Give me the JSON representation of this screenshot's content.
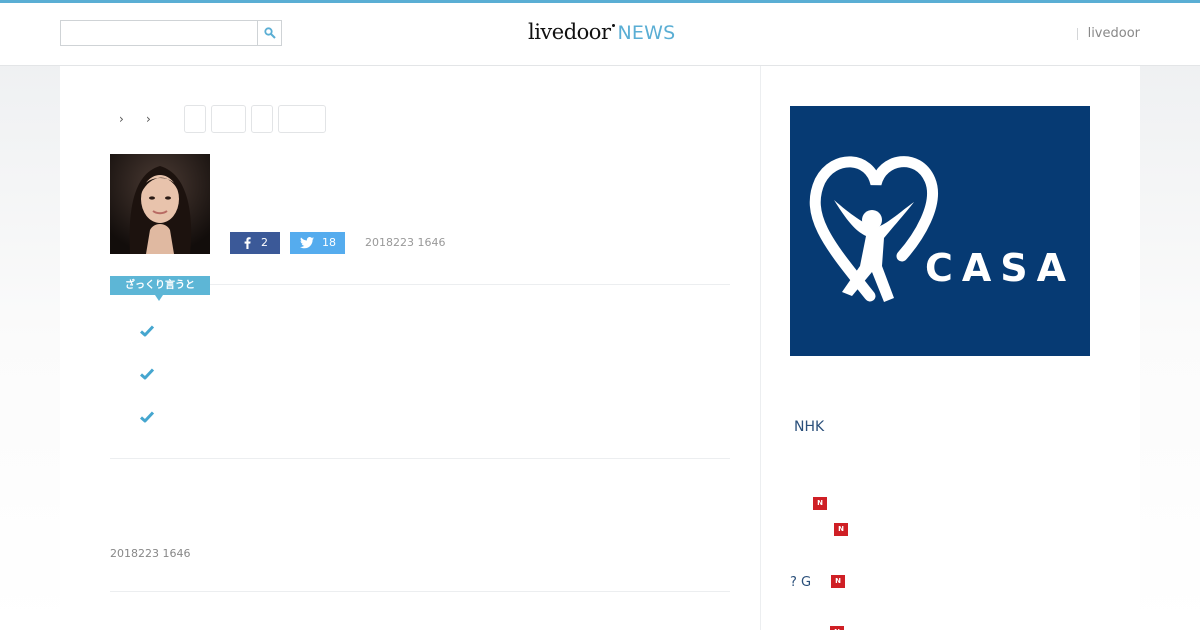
{
  "header": {
    "search_placeholder": "",
    "logo_main": "livedoor",
    "logo_news": "NEWS",
    "right_link": "livedoor"
  },
  "share": {
    "facebook_count": "2",
    "twitter_count": "18"
  },
  "article": {
    "date": "2018223 1646",
    "summary_label": "ざっくり言うと",
    "bottom_date": "2018223 1646"
  },
  "ad": {
    "brand_text": "CASA",
    "reg_mark": "®"
  },
  "sidebar": {
    "headline": "NHK",
    "items": [
      {
        "text": "",
        "badge": "N"
      },
      {
        "text": "",
        "badge": "N"
      },
      {
        "text": "? G",
        "badge": "N"
      },
      {
        "text": "",
        "badge": "N"
      }
    ]
  },
  "colors": {
    "accent": "#5aaed4",
    "facebook": "#3b5998",
    "twitter": "#55acee",
    "ad_background": "#063a73",
    "new_badge": "#cf1f25"
  }
}
